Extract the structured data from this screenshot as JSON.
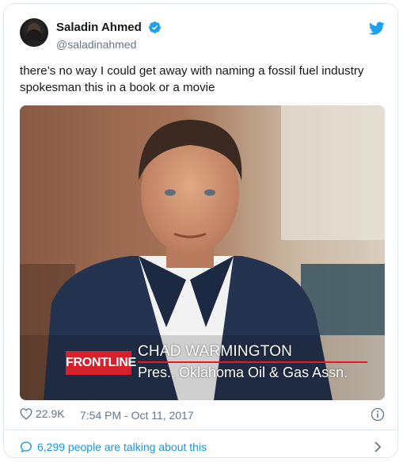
{
  "author": {
    "display_name": "Saladin Ahmed",
    "handle": "@saladinahmed",
    "verified": true,
    "avatar_icon": "avatar"
  },
  "tweet": {
    "text": "there’s no way I could get away with naming a fossil fuel industry spokesman this in a book or a movie"
  },
  "media": {
    "badge": "FRONTLINE",
    "name": "CHAD WARMINGTON",
    "title": "Pres., Oklahoma Oil & Gas Assn."
  },
  "meta": {
    "likes": "22.9K",
    "timestamp": "7:54 PM - Oct 11, 2017"
  },
  "footer": {
    "conversation": "6,299 people are talking about this"
  },
  "colors": {
    "brand_blue": "#1da1f2",
    "link_blue": "#1b95e0",
    "muted": "#657786",
    "frontline_red": "#d6202b"
  },
  "icons": [
    "twitter-bird-icon",
    "verified-badge-icon",
    "heart-icon",
    "info-icon",
    "speech-bubble-icon",
    "chevron-right-icon"
  ]
}
